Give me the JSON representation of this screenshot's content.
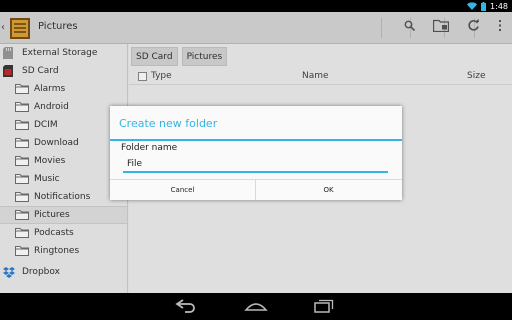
{
  "status_bar": {
    "time": "1:48"
  },
  "action_bar": {
    "title": "Pictures",
    "actions": [
      "search-icon",
      "new-folder-icon",
      "refresh-icon",
      "overflow-menu-icon"
    ]
  },
  "sidebar": {
    "items": [
      {
        "label": "External Storage",
        "icon": "sd-card-icon",
        "level": 0
      },
      {
        "label": "SD Card",
        "icon": "sd-card-red-icon",
        "level": 0
      },
      {
        "label": "Alarms",
        "icon": "folder-icon",
        "level": 1
      },
      {
        "label": "Android",
        "icon": "folder-icon",
        "level": 1
      },
      {
        "label": "DCIM",
        "icon": "folder-icon",
        "level": 1
      },
      {
        "label": "Download",
        "icon": "folder-icon",
        "level": 1
      },
      {
        "label": "Movies",
        "icon": "folder-icon",
        "level": 1
      },
      {
        "label": "Music",
        "icon": "folder-icon",
        "level": 1
      },
      {
        "label": "Notifications",
        "icon": "folder-icon",
        "level": 1
      },
      {
        "label": "Pictures",
        "icon": "folder-icon",
        "level": 1,
        "selected": true
      },
      {
        "label": "Podcasts",
        "icon": "folder-icon",
        "level": 1
      },
      {
        "label": "Ringtones",
        "icon": "folder-icon",
        "level": 1
      },
      {
        "label": "Dropbox",
        "icon": "dropbox-icon",
        "level": 0
      }
    ]
  },
  "breadcrumbs": [
    "SD Card",
    "Pictures"
  ],
  "columns": {
    "type": "Type",
    "name": "Name",
    "size": "Size"
  },
  "dialog": {
    "title": "Create new folder",
    "field_label": "Folder name",
    "field_value": "File",
    "cancel_label": "Cancel",
    "ok_label": "OK"
  },
  "colors": {
    "accent": "#33b5e5",
    "folder": "#6f6f6f"
  }
}
